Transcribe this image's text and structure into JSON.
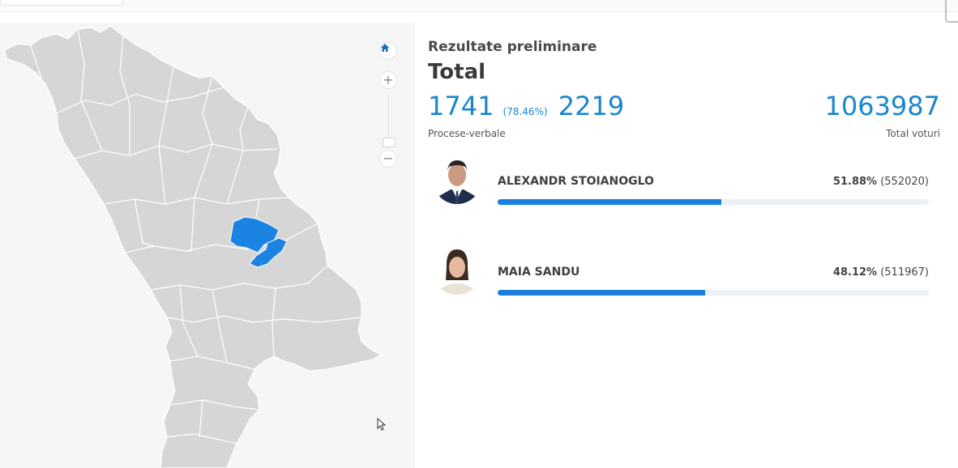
{
  "colors": {
    "accent": "#1a86d0",
    "bar_fill": "#1a7fdd",
    "map_region": "#d6d6d6",
    "map_selected": "#1b84e2"
  },
  "map": {
    "controls": [
      {
        "name": "home",
        "icon": "home-icon"
      },
      {
        "name": "zoom-in",
        "icon": "plus-icon",
        "glyph": "+"
      },
      {
        "name": "zoom-out",
        "icon": "minus-icon",
        "glyph": "−"
      }
    ]
  },
  "results": {
    "subtitle": "Rezultate preliminare",
    "title": "Total",
    "protocols_counted": "1741",
    "protocols_percent": "(78.46%)",
    "protocols_total": "2219",
    "protocols_label": "Procese-verbale",
    "total_votes": "1063987",
    "total_votes_label": "Total voturi"
  },
  "candidates": [
    {
      "name": "ALEXANDR STOIANOGLO",
      "percent": "51.88%",
      "votes": "(552020)",
      "share": 0.5188
    },
    {
      "name": "MAIA SANDU",
      "percent": "48.12%",
      "votes": "(511967)",
      "share": 0.4812
    }
  ]
}
